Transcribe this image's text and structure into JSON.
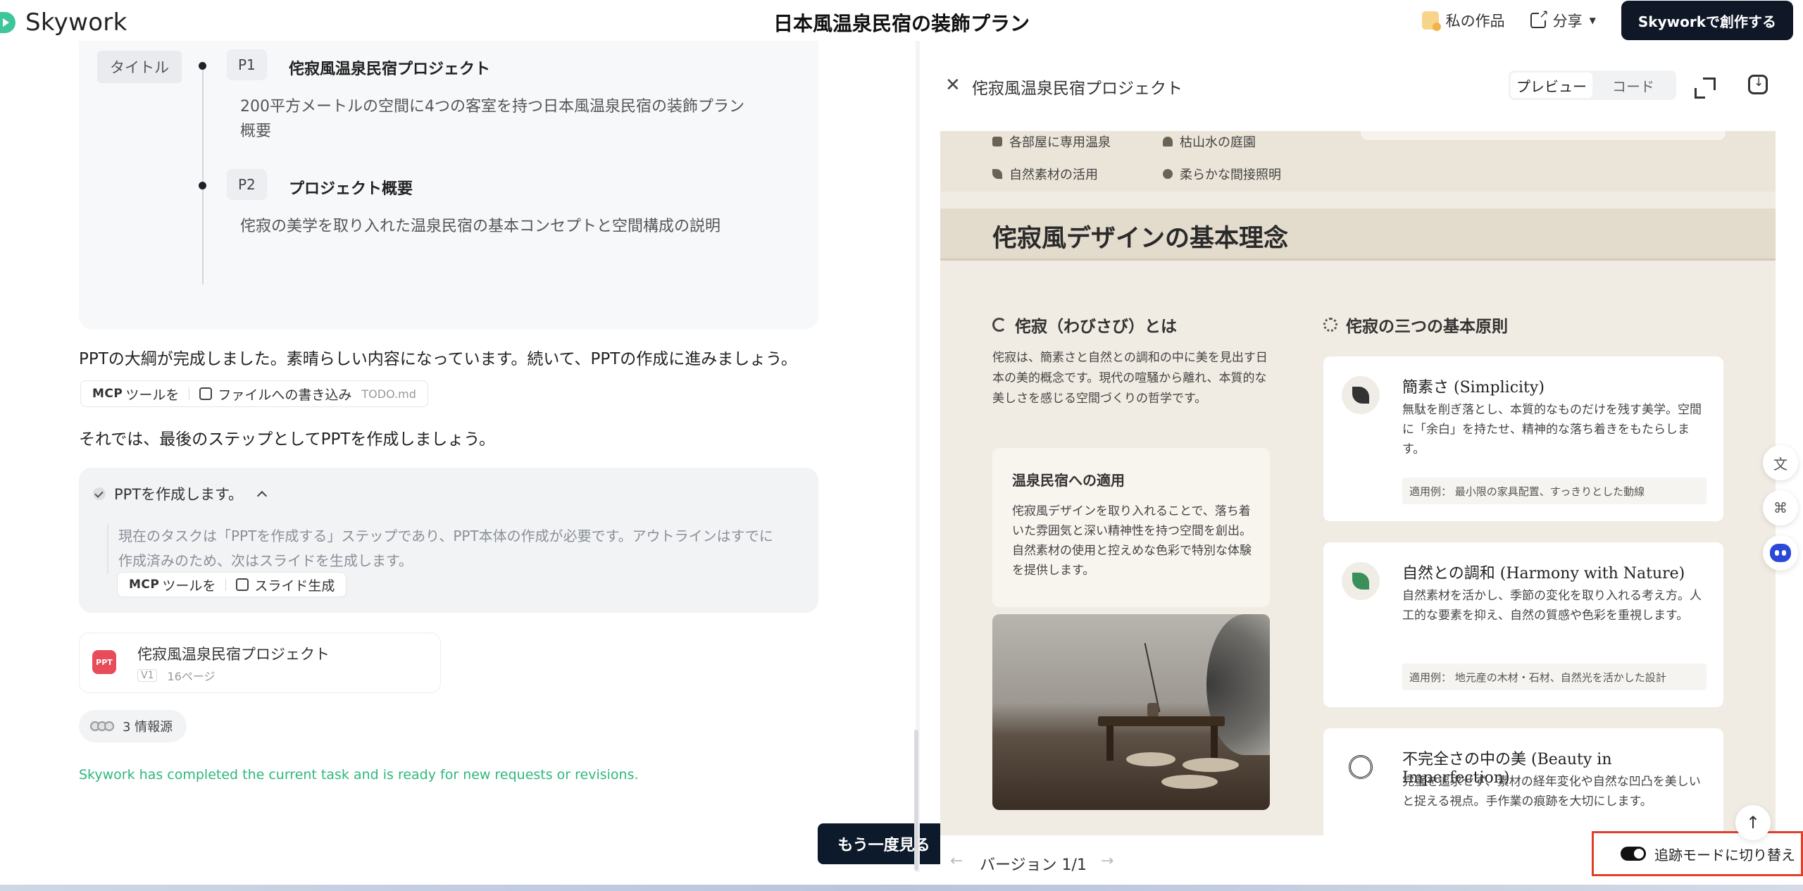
{
  "header": {
    "logo_text": "Skywork",
    "title": "日本風温泉民宿の装飾プラン",
    "my_works": "私の作品",
    "share": "分享",
    "create": "Skyworkで創作する"
  },
  "outline": {
    "tag": "タイトル",
    "slides": [
      {
        "no": "P1",
        "title": "侘寂風温泉民宿プロジェクト",
        "desc": "200平方メートルの空間に4つの客室を持つ日本風温泉民宿の装飾プラン概要"
      },
      {
        "no": "P2",
        "title": "プロジェクト概要",
        "desc": "侘寂の美学を取り入れた温泉民宿の基本コンセプトと空間構成の説明"
      }
    ]
  },
  "chat": {
    "msg1": "PPTの大綱が完成しました。素晴らしい内容になっています。続いて、PPTの作成に進みましょう。",
    "tool1": {
      "mcp": "MCP",
      "tool_label": "ツールを",
      "action": "ファイルへの書き込み",
      "file": "TODO.md"
    },
    "msg2": "それでは、最後のステップとしてPPTを作成しましょう。",
    "task": {
      "title": "PPTを作成します。",
      "body": "現在のタスクは「PPTを作成する」ステップであり、PPT本体の作成が必要です。アウトラインはすでに作成済みのため、次はスライドを生成します。",
      "tool": {
        "mcp": "MCP",
        "tool_label": "ツールを",
        "action": "スライド生成"
      }
    },
    "ppt": {
      "badge": "PPT",
      "name": "侘寂風温泉民宿プロジェクト",
      "version": "V1",
      "pages": "16ページ"
    },
    "sources": "3 情報源",
    "done": "Skywork has completed the current task and is ready for new requests or revisions.",
    "again": "もう一度見る"
  },
  "panel": {
    "title": "侘寂風温泉民宿プロジェクト",
    "tab_preview": "プレビュー",
    "tab_code": "コード",
    "version": "バージョン 1/1",
    "toggle": "追跡モードに切り替え"
  },
  "slide": {
    "features": [
      "各部屋に専用温泉",
      "枯山水の庭園",
      "自然素材の活用",
      "柔らかな間接照明"
    ],
    "heading": "侘寂風デザインの基本理念",
    "left_head": "侘寂（わびさび）とは",
    "left_text": "侘寂は、簡素さと自然との調和の中に美を見出す日本の美的概念です。現代の喧騒から離れ、本質的な美しさを感じる空間づくりの哲学です。",
    "apply_title": "温泉民宿への適用",
    "apply_text": "侘寂風デザインを取り入れることで、落ち着いた雰囲気と深い精神性を持つ空間を創出。自然素材の使用と控えめな色彩で特別な体験を提供します。",
    "right_head": "侘寂の三つの基本原則",
    "principles": [
      {
        "title": "簡素さ (Simplicity)",
        "text": "無駄を削ぎ落とし、本質的なものだけを残す美学。空間に「余白」を持たせ、精神的な落ち着きをもたらします。",
        "example": "適用例： 最小限の家具配置、すっきりとした動線"
      },
      {
        "title": "自然との調和 (Harmony with Nature)",
        "text": "自然素材を活かし、季節の変化を取り入れる考え方。人工的な要素を抑え、自然の質感や色彩を重視します。",
        "example": "適用例： 地元産の木材・石材、自然光を活かした設計"
      },
      {
        "title": "不完全さの中の美 (Beauty in Imperfection)",
        "text": "完璧を追求せず、素材の経年変化や自然な凹凸を美しいと捉える視点。手作業の痕跡を大切にします。",
        "example": ""
      }
    ]
  },
  "colors": {
    "accent": "#101828",
    "success": "#2eb87a",
    "highlight_border": "#e0402a",
    "ppt_badge": "#e84b5a"
  }
}
